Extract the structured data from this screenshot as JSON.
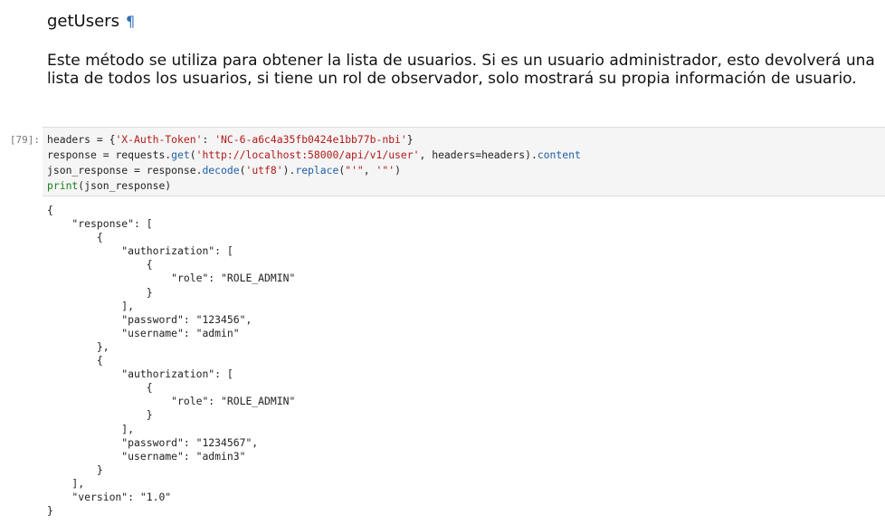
{
  "heading": {
    "text": "getUsers",
    "anchor": "¶"
  },
  "markdown": {
    "text": "Este método se utiliza para obtener la lista de usuarios. Si es un usuario administrador, esto devolverá una lista de todos los usuarios, si tiene un rol de observador, solo mostrará su propia información de usuario."
  },
  "cell": {
    "prompt": "[79]:",
    "code": {
      "line1": {
        "var": "headers",
        "eq": " = {",
        "key": "'X-Auth-Token'",
        "colon": ": ",
        "val": "'NC-6-a6c4a35fb0424e1bb77b-nbi'",
        "close": "}"
      },
      "line2": {
        "var": "response",
        "eq": " = requests.",
        "fn": "get",
        "open": "(",
        "url": "'http://localhost:58000/api/v1/user'",
        "args": ", headers=headers).",
        "attr": "content"
      },
      "line3": {
        "var": "json_response",
        "eq": " = response.",
        "fn1": "decode",
        "open1": "(",
        "enc": "'utf8'",
        "mid": ").",
        "fn2": "replace",
        "open2": "(",
        "a1": "\"'\"",
        "comma": ", ",
        "a2": "'\"'",
        "close": ")"
      },
      "line4": {
        "fn": "print",
        "rest": "(json_response)"
      }
    }
  },
  "output": {
    "text": "{\n    \"response\": [\n        {\n            \"authorization\": [\n                {\n                    \"role\": \"ROLE_ADMIN\"\n                }\n            ],\n            \"password\": \"123456\",\n            \"username\": \"admin\"\n        },\n        {\n            \"authorization\": [\n                {\n                    \"role\": \"ROLE_ADMIN\"\n                }\n            ],\n            \"password\": \"1234567\",\n            \"username\": \"admin3\"\n        }\n    ],\n    \"version\": \"1.0\"\n}"
  }
}
